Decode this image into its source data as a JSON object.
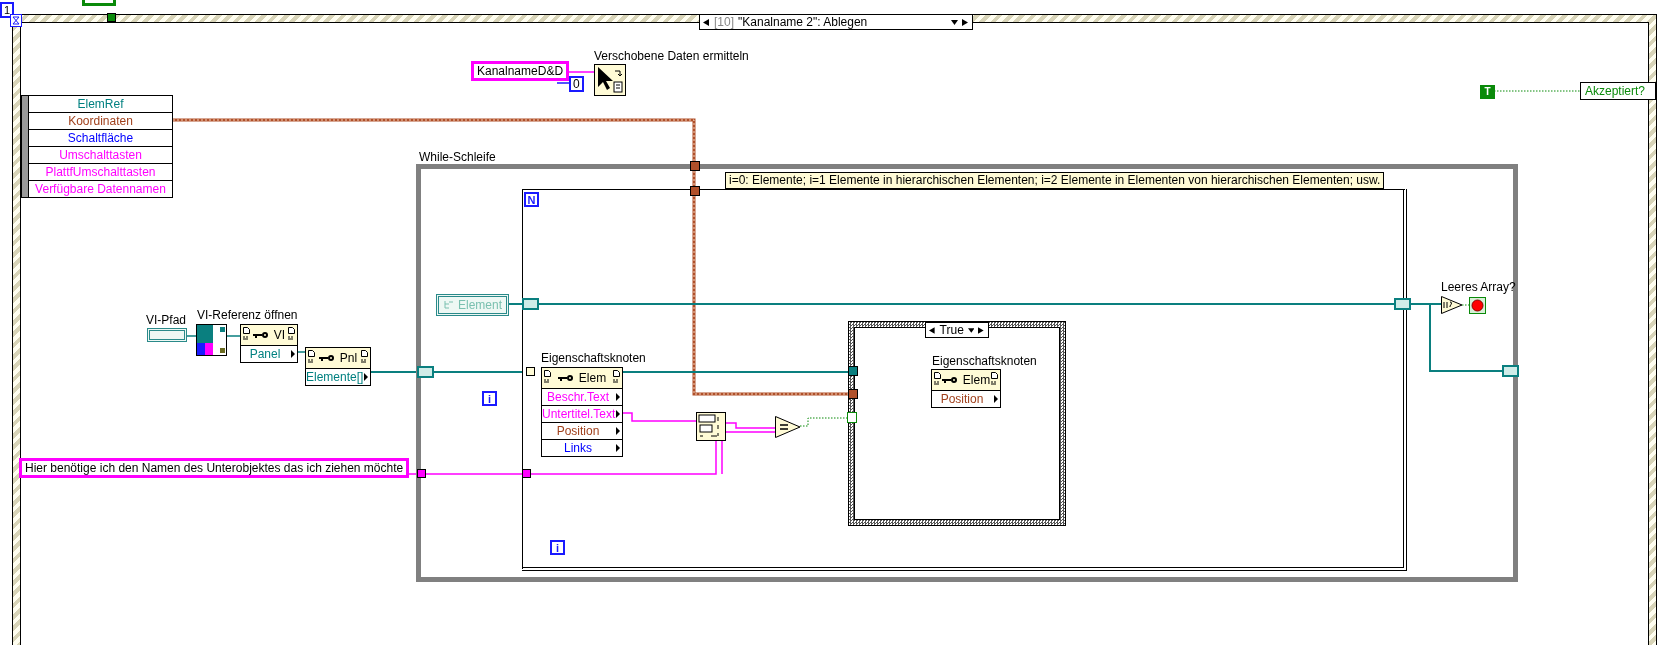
{
  "top_counter": "1",
  "case_selector": {
    "index": "[10]",
    "label": "\"Kanalname 2\": Ablegen"
  },
  "event_data_node": {
    "items": [
      {
        "label": "ElemRef",
        "color": "#008080"
      },
      {
        "label": "Koordinaten",
        "color": "#a0401c"
      },
      {
        "label": "Schaltfläche",
        "color": "#0000ff"
      },
      {
        "label": "Umschalttasten",
        "color": "#ff00ff"
      },
      {
        "label": "PlattfUmschalttasten",
        "color": "#ff00ff"
      },
      {
        "label": "Verfügbare Datennamen",
        "color": "#ff00ff"
      }
    ]
  },
  "drag_data": {
    "string_constant": "KanalnameD&D",
    "numeric_constant": "0",
    "function_label": "Verschobene Daten ermitteln"
  },
  "boolean_constant": "T",
  "accepted_indicator": "Akzeptiert?",
  "while_loop": {
    "label": "While-Schleife",
    "comment": "i=0: Elemente; i=1 Elemente in hierarchischen Elementen; i=2 Elemente in Elementen von hierarchischen Elementen; usw.",
    "iteration": "i",
    "stop_label": "Leeres Array?"
  },
  "for_loop": {
    "count": "N",
    "iteration": "i"
  },
  "element_constant": "Element",
  "vi_path_label": "VI-Pfad",
  "open_reference_label": "VI-Referenz öffnen",
  "vi_node": {
    "class": "VI",
    "properties": [
      {
        "label": "Panel",
        "color": "#008080"
      }
    ]
  },
  "panel_node": {
    "class": "Pnl",
    "properties": [
      {
        "label": "Elemente[]",
        "color": "#008080"
      }
    ]
  },
  "property_node": {
    "label": "Eigenschaftsknoten",
    "class": "Elem",
    "properties": [
      {
        "label": "Beschr.Text",
        "color": "#ff00ff"
      },
      {
        "label": "Untertitel.Text",
        "color": "#ff00ff"
      },
      {
        "label": "Position",
        "color": "#a0401c"
      },
      {
        "label": "Links",
        "color": "#0000ff"
      }
    ]
  },
  "case_structure": {
    "selector": "True",
    "node_label": "Eigenschaftsknoten",
    "node_class": "Elem",
    "node_properties": [
      {
        "label": "Position",
        "color": "#a0401c"
      }
    ]
  },
  "name_constant": "Hier benötige ich den Namen des Unterobjektes das ich ziehen möchte"
}
